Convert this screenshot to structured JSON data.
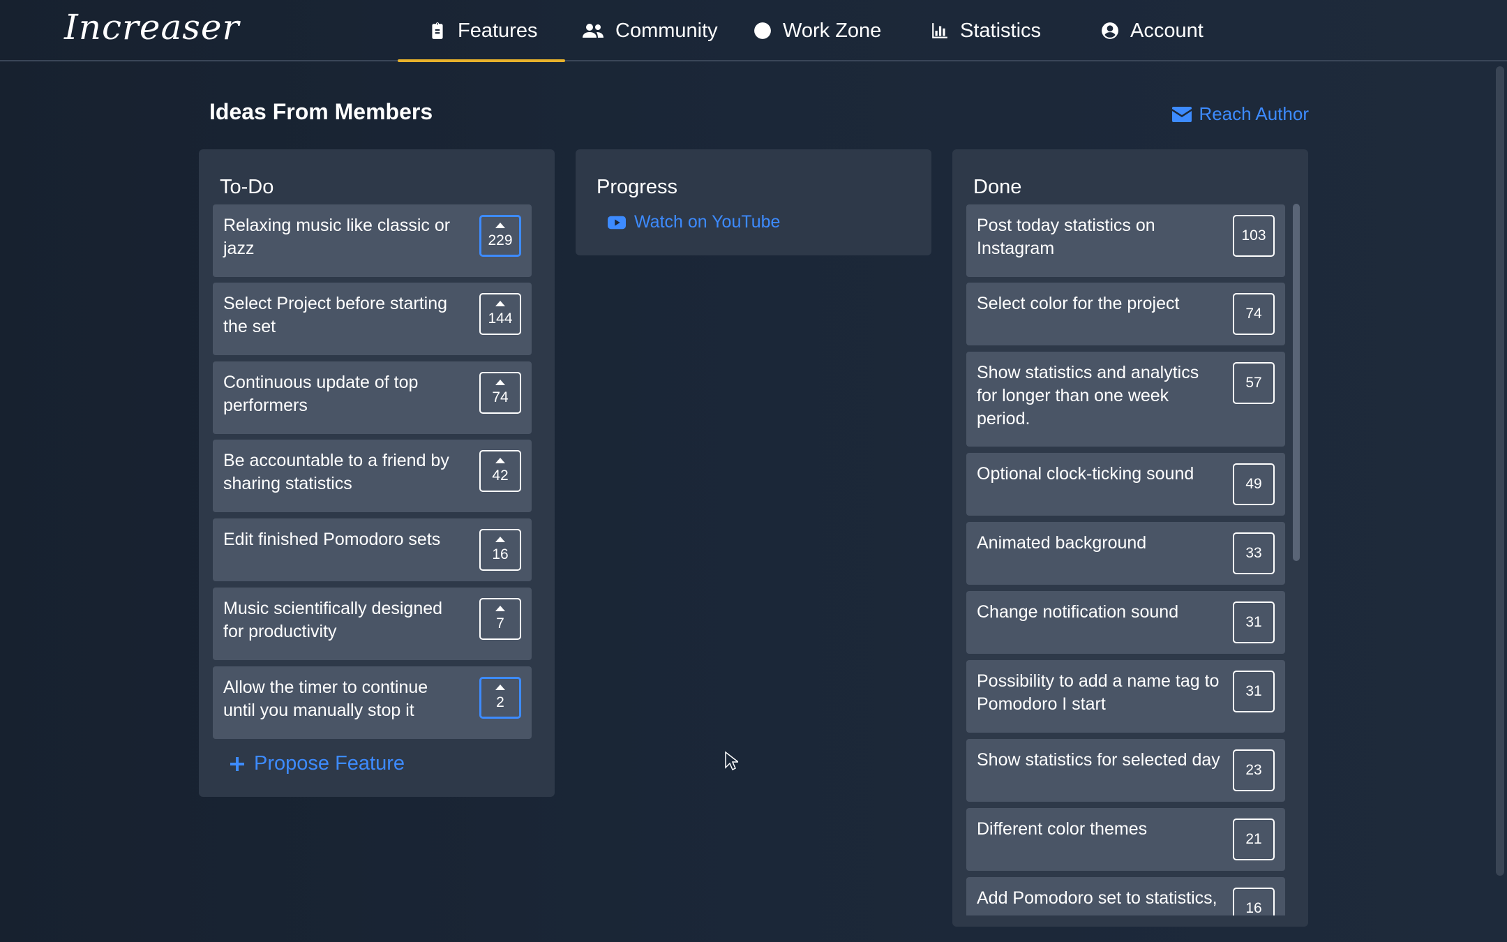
{
  "app": {
    "logo": "Increaser"
  },
  "nav": [
    {
      "label": "Features",
      "icon": "clipboard-icon",
      "active": true
    },
    {
      "label": "Community",
      "icon": "users-icon",
      "active": false
    },
    {
      "label": "Work Zone",
      "icon": "clock-icon",
      "active": false
    },
    {
      "label": "Statistics",
      "icon": "bar-chart-icon",
      "active": false
    },
    {
      "label": "Account",
      "icon": "user-circle-icon",
      "active": false
    }
  ],
  "colors": {
    "accent": "#3d8bff",
    "active_nav": "#e8b22c",
    "card": "#4a5566",
    "column": "#2e3949"
  },
  "page": {
    "title": "Ideas From Members",
    "reach_author": "Reach Author"
  },
  "todo": {
    "title": "To-Do",
    "items": [
      {
        "text": "Relaxing music like classic or jazz",
        "votes": "229",
        "selected": true
      },
      {
        "text": "Select Project before starting the set",
        "votes": "144",
        "selected": false
      },
      {
        "text": "Continuous update of top performers",
        "votes": "74",
        "selected": false
      },
      {
        "text": "Be accountable to a friend by sharing statistics",
        "votes": "42",
        "selected": false
      },
      {
        "text": "Edit finished Pomodoro sets",
        "votes": "16",
        "selected": false
      },
      {
        "text": "Music scientifically designed for productivity",
        "votes": "7",
        "selected": false
      },
      {
        "text": "Allow the timer to continue until you manually stop it",
        "votes": "2",
        "selected": true
      }
    ],
    "propose": "Propose Feature"
  },
  "progress": {
    "title": "Progress",
    "youtube": "Watch on YouTube"
  },
  "done": {
    "title": "Done",
    "items": [
      {
        "text": "Post today statistics on Instagram",
        "votes": "103"
      },
      {
        "text": "Select color for the project",
        "votes": "74"
      },
      {
        "text": "Show statistics and analytics for longer than one week period.",
        "votes": "57"
      },
      {
        "text": "Optional clock-ticking sound",
        "votes": "49"
      },
      {
        "text": "Animated background",
        "votes": "33"
      },
      {
        "text": "Change notification sound",
        "votes": "31"
      },
      {
        "text": "Possibility to add a name tag to Pomodoro I start",
        "votes": "31"
      },
      {
        "text": "Show statistics for selected day",
        "votes": "23"
      },
      {
        "text": "Different color themes",
        "votes": "21"
      },
      {
        "text": "Add Pomodoro set to statistics,",
        "votes": "16"
      }
    ]
  }
}
